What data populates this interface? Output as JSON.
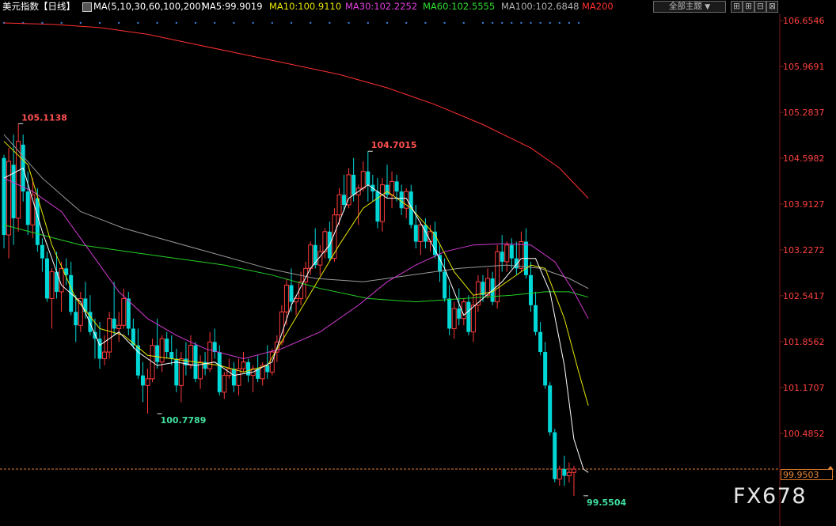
{
  "header": {
    "instrument": "美元指数",
    "period": "【日线】",
    "ma_set": "MA(5,10,30,60,100,200)",
    "ma5": "MA5:99.9019",
    "ma10": "MA10:100.9110",
    "ma30": "MA30:102.2252",
    "ma60": "MA60:102.5555",
    "ma100": "MA100:102.6848",
    "ma200": "MA200",
    "theme_select": "全部主题",
    "theme_arrow": "▼",
    "buttons": [
      "⊞",
      "⊞",
      "⊟",
      "⊠"
    ]
  },
  "watermark": "FX678",
  "current_price": "99.9503",
  "colors": {
    "up": "#ff3b3b",
    "down": "#00d8d8",
    "ma5": "#ffffff",
    "ma10": "#e6e600",
    "ma30": "#d23ad2",
    "ma60": "#26d026",
    "ma100": "#9a9a9a",
    "ma200": "#ff3030",
    "axis_text": "#ff4040",
    "current_line": "#e07a30"
  },
  "chart_data": {
    "type": "candlestick",
    "ylim": [
      99.3,
      106.75
    ],
    "y_ticks": [
      "106.6546",
      "105.9691",
      "105.2837",
      "104.5982",
      "103.9127",
      "103.2272",
      "102.5417",
      "101.8562",
      "101.1707",
      "100.4852",
      "99.9503"
    ],
    "annotations": [
      {
        "text": "105.1138",
        "value": 105.1138,
        "index": 3
      },
      {
        "text": "104.7015",
        "value": 104.7015,
        "index": 76
      },
      {
        "text": "100.7789",
        "value": 100.7789,
        "index": 32
      },
      {
        "text": "99.5504",
        "value": 99.5504,
        "index": 121
      }
    ],
    "ohlc": [
      [
        104.6,
        104.65,
        103.25,
        103.45
      ],
      [
        103.45,
        104.75,
        103.1,
        104.55
      ],
      [
        104.5,
        104.95,
        103.3,
        103.7
      ],
      [
        103.7,
        105.11,
        103.5,
        104.85
      ],
      [
        104.8,
        104.95,
        103.95,
        104.1
      ],
      [
        104.1,
        104.4,
        103.45,
        103.6
      ],
      [
        103.6,
        104.3,
        103.4,
        104.05
      ],
      [
        104.0,
        104.15,
        103.2,
        103.3
      ],
      [
        103.3,
        103.4,
        102.9,
        103.1
      ],
      [
        103.1,
        103.2,
        102.45,
        102.5
      ],
      [
        102.5,
        102.95,
        102.05,
        102.9
      ],
      [
        102.9,
        103.2,
        102.5,
        102.6
      ],
      [
        102.6,
        103.05,
        102.3,
        102.95
      ],
      [
        102.95,
        103.1,
        102.7,
        102.85
      ],
      [
        102.85,
        103.05,
        102.25,
        102.3
      ],
      [
        102.3,
        102.55,
        101.85,
        102.1
      ],
      [
        102.1,
        102.6,
        102.0,
        102.5
      ],
      [
        102.5,
        102.75,
        102.2,
        102.3
      ],
      [
        102.3,
        102.55,
        101.95,
        102.0
      ],
      [
        102.0,
        102.2,
        101.6,
        101.9
      ],
      [
        101.9,
        102.15,
        101.45,
        101.6
      ],
      [
        101.6,
        101.95,
        101.5,
        101.7
      ],
      [
        101.7,
        102.3,
        101.6,
        102.2
      ],
      [
        102.2,
        102.75,
        101.95,
        102.05
      ],
      [
        102.05,
        102.3,
        101.85,
        102.1
      ],
      [
        102.1,
        102.65,
        102.05,
        102.5
      ],
      [
        102.5,
        102.6,
        101.95,
        102.05
      ],
      [
        102.05,
        102.2,
        101.75,
        101.8
      ],
      [
        101.8,
        102.05,
        101.3,
        101.35
      ],
      [
        101.35,
        101.55,
        100.95,
        101.2
      ],
      [
        101.2,
        101.45,
        100.78,
        101.3
      ],
      [
        101.3,
        101.9,
        101.25,
        101.8
      ],
      [
        101.8,
        102.2,
        101.45,
        101.55
      ],
      [
        101.55,
        101.95,
        101.4,
        101.9
      ],
      [
        101.9,
        102.0,
        101.6,
        101.7
      ],
      [
        101.7,
        101.95,
        101.5,
        101.6
      ],
      [
        101.6,
        101.75,
        101.1,
        101.2
      ],
      [
        101.2,
        101.7,
        100.95,
        101.6
      ],
      [
        101.6,
        101.85,
        101.35,
        101.5
      ],
      [
        101.5,
        101.95,
        101.45,
        101.8
      ],
      [
        101.8,
        101.85,
        101.25,
        101.3
      ],
      [
        101.3,
        101.65,
        101.15,
        101.55
      ],
      [
        101.55,
        101.7,
        101.35,
        101.45
      ],
      [
        101.45,
        102.0,
        101.4,
        101.85
      ],
      [
        101.85,
        102.05,
        101.6,
        101.7
      ],
      [
        101.7,
        101.8,
        101.05,
        101.1
      ],
      [
        101.1,
        101.4,
        101.0,
        101.35
      ],
      [
        101.35,
        101.6,
        101.3,
        101.45
      ],
      [
        101.45,
        101.55,
        101.1,
        101.2
      ],
      [
        101.2,
        101.6,
        101.05,
        101.45
      ],
      [
        101.45,
        101.7,
        101.4,
        101.55
      ],
      [
        101.55,
        101.6,
        101.25,
        101.35
      ],
      [
        101.35,
        101.5,
        101.1,
        101.45
      ],
      [
        101.45,
        101.65,
        101.25,
        101.3
      ],
      [
        101.3,
        101.55,
        101.2,
        101.5
      ],
      [
        101.5,
        101.8,
        101.3,
        101.4
      ],
      [
        101.4,
        101.75,
        101.35,
        101.7
      ],
      [
        101.7,
        101.95,
        101.55,
        101.85
      ],
      [
        101.85,
        102.4,
        101.8,
        102.3
      ],
      [
        102.3,
        102.8,
        102.1,
        102.7
      ],
      [
        102.7,
        102.95,
        102.3,
        102.45
      ],
      [
        102.45,
        102.55,
        102.25,
        102.5
      ],
      [
        102.5,
        102.9,
        102.4,
        102.75
      ],
      [
        102.75,
        103.05,
        102.5,
        102.95
      ],
      [
        102.95,
        103.35,
        102.85,
        103.3
      ],
      [
        103.3,
        103.55,
        102.95,
        103.0
      ],
      [
        103.0,
        103.3,
        102.85,
        103.2
      ],
      [
        103.2,
        103.55,
        103.1,
        103.5
      ],
      [
        103.5,
        103.65,
        103.05,
        103.1
      ],
      [
        103.1,
        103.85,
        103.05,
        103.75
      ],
      [
        103.75,
        104.15,
        103.6,
        104.05
      ],
      [
        104.05,
        104.35,
        103.8,
        103.9
      ],
      [
        103.9,
        104.45,
        103.85,
        104.35
      ],
      [
        104.35,
        104.6,
        103.95,
        104.05
      ],
      [
        104.05,
        104.2,
        103.6,
        104.15
      ],
      [
        104.15,
        104.55,
        104.1,
        104.4
      ],
      [
        104.4,
        104.7,
        103.95,
        104.2
      ],
      [
        104.2,
        104.35,
        103.95,
        104.1
      ],
      [
        104.1,
        104.3,
        103.55,
        103.65
      ],
      [
        103.65,
        104.3,
        103.5,
        104.2
      ],
      [
        104.2,
        104.5,
        104.0,
        104.05
      ],
      [
        104.05,
        104.4,
        103.85,
        104.25
      ],
      [
        104.25,
        104.35,
        103.95,
        104.1
      ],
      [
        104.1,
        104.2,
        103.75,
        103.85
      ],
      [
        103.85,
        104.15,
        103.7,
        104.1
      ],
      [
        104.1,
        104.2,
        103.55,
        103.6
      ],
      [
        103.6,
        103.9,
        103.25,
        103.35
      ],
      [
        103.35,
        103.65,
        103.15,
        103.6
      ],
      [
        103.6,
        103.7,
        103.25,
        103.35
      ],
      [
        103.35,
        103.6,
        103.2,
        103.5
      ],
      [
        103.5,
        103.65,
        103.1,
        103.15
      ],
      [
        103.15,
        103.3,
        102.75,
        102.9
      ],
      [
        102.9,
        103.1,
        102.45,
        102.5
      ],
      [
        102.5,
        102.7,
        101.95,
        102.05
      ],
      [
        102.05,
        102.45,
        101.9,
        102.35
      ],
      [
        102.35,
        102.65,
        102.1,
        102.2
      ],
      [
        102.2,
        102.5,
        102.1,
        102.45
      ],
      [
        102.45,
        102.55,
        101.95,
        102.0
      ],
      [
        102.0,
        102.55,
        101.85,
        102.4
      ],
      [
        102.4,
        102.85,
        102.3,
        102.75
      ],
      [
        102.75,
        102.85,
        102.45,
        102.55
      ],
      [
        102.55,
        102.95,
        102.5,
        102.8
      ],
      [
        102.8,
        102.9,
        102.4,
        102.45
      ],
      [
        102.45,
        103.3,
        102.35,
        103.2
      ],
      [
        103.2,
        103.45,
        102.9,
        103.05
      ],
      [
        103.05,
        103.35,
        102.9,
        103.3
      ],
      [
        103.3,
        103.4,
        102.95,
        103.1
      ],
      [
        103.1,
        103.35,
        102.85,
        102.95
      ],
      [
        102.95,
        103.5,
        102.9,
        103.35
      ],
      [
        103.35,
        103.55,
        102.8,
        102.85
      ],
      [
        102.85,
        103.05,
        102.3,
        102.4
      ],
      [
        102.4,
        102.6,
        101.95,
        102.0
      ],
      [
        102.0,
        102.15,
        101.65,
        101.7
      ],
      [
        101.7,
        101.85,
        101.15,
        101.2
      ],
      [
        101.2,
        101.25,
        100.45,
        100.5
      ],
      [
        100.5,
        100.55,
        99.75,
        99.8
      ],
      [
        99.8,
        100.0,
        99.7,
        99.95
      ],
      [
        99.95,
        100.15,
        99.7,
        99.85
      ],
      [
        99.85,
        100.05,
        99.75,
        99.9
      ],
      [
        99.9,
        100.0,
        99.55,
        99.95
      ]
    ],
    "ma_names": [
      "MA5",
      "MA10",
      "MA30",
      "MA60",
      "MA100",
      "MA200"
    ],
    "ma200": [
      [
        0,
        106.62
      ],
      [
        10,
        106.6
      ],
      [
        20,
        106.55
      ],
      [
        30,
        106.45
      ],
      [
        40,
        106.3
      ],
      [
        50,
        106.15
      ],
      [
        60,
        106.0
      ],
      [
        70,
        105.85
      ],
      [
        80,
        105.65
      ],
      [
        90,
        105.4
      ],
      [
        100,
        105.1
      ],
      [
        110,
        104.75
      ],
      [
        116,
        104.45
      ],
      [
        122,
        104.0
      ]
    ],
    "ma100": [
      [
        0,
        104.95
      ],
      [
        8,
        104.3
      ],
      [
        16,
        103.8
      ],
      [
        25,
        103.55
      ],
      [
        35,
        103.35
      ],
      [
        45,
        103.15
      ],
      [
        55,
        102.95
      ],
      [
        65,
        102.8
      ],
      [
        75,
        102.75
      ],
      [
        85,
        102.85
      ],
      [
        95,
        102.95
      ],
      [
        105,
        103.0
      ],
      [
        112,
        102.95
      ],
      [
        118,
        102.8
      ],
      [
        122,
        102.65
      ]
    ],
    "ma60": [
      [
        0,
        103.6
      ],
      [
        8,
        103.45
      ],
      [
        16,
        103.3
      ],
      [
        26,
        103.2
      ],
      [
        36,
        103.1
      ],
      [
        46,
        103.0
      ],
      [
        56,
        102.85
      ],
      [
        66,
        102.65
      ],
      [
        76,
        102.5
      ],
      [
        86,
        102.45
      ],
      [
        96,
        102.5
      ],
      [
        106,
        102.55
      ],
      [
        113,
        102.6
      ],
      [
        118,
        102.6
      ],
      [
        122,
        102.52
      ]
    ],
    "ma30": [
      [
        0,
        104.3
      ],
      [
        6,
        104.1
      ],
      [
        12,
        103.8
      ],
      [
        18,
        103.2
      ],
      [
        24,
        102.6
      ],
      [
        30,
        102.2
      ],
      [
        36,
        101.95
      ],
      [
        42,
        101.75
      ],
      [
        50,
        101.6
      ],
      [
        58,
        101.75
      ],
      [
        66,
        102.0
      ],
      [
        74,
        102.4
      ],
      [
        80,
        102.75
      ],
      [
        86,
        103.0
      ],
      [
        92,
        103.2
      ],
      [
        98,
        103.3
      ],
      [
        104,
        103.32
      ],
      [
        110,
        103.3
      ],
      [
        115,
        103.05
      ],
      [
        119,
        102.6
      ],
      [
        122,
        102.2
      ]
    ],
    "ma10": [
      [
        0,
        104.85
      ],
      [
        5,
        104.5
      ],
      [
        10,
        103.3
      ],
      [
        15,
        102.5
      ],
      [
        20,
        102.05
      ],
      [
        25,
        101.95
      ],
      [
        30,
        101.65
      ],
      [
        35,
        101.6
      ],
      [
        40,
        101.55
      ],
      [
        45,
        101.5
      ],
      [
        50,
        101.4
      ],
      [
        55,
        101.5
      ],
      [
        60,
        102.1
      ],
      [
        65,
        102.7
      ],
      [
        70,
        103.3
      ],
      [
        75,
        103.85
      ],
      [
        80,
        104.1
      ],
      [
        85,
        103.85
      ],
      [
        90,
        103.45
      ],
      [
        94,
        102.9
      ],
      [
        98,
        102.55
      ],
      [
        102,
        102.6
      ],
      [
        106,
        102.8
      ],
      [
        110,
        103.0
      ],
      [
        113,
        102.95
      ],
      [
        117,
        102.2
      ],
      [
        120,
        101.4
      ],
      [
        122,
        100.9
      ]
    ],
    "ma5": [
      [
        0,
        104.3
      ],
      [
        4,
        104.45
      ],
      [
        8,
        103.5
      ],
      [
        12,
        102.7
      ],
      [
        16,
        102.45
      ],
      [
        20,
        101.8
      ],
      [
        24,
        102.0
      ],
      [
        28,
        101.7
      ],
      [
        32,
        101.5
      ],
      [
        36,
        101.55
      ],
      [
        40,
        101.5
      ],
      [
        44,
        101.55
      ],
      [
        48,
        101.35
      ],
      [
        52,
        101.4
      ],
      [
        56,
        101.55
      ],
      [
        60,
        102.4
      ],
      [
        64,
        102.95
      ],
      [
        68,
        103.3
      ],
      [
        72,
        104.0
      ],
      [
        76,
        104.2
      ],
      [
        80,
        104.0
      ],
      [
        84,
        104.0
      ],
      [
        88,
        103.5
      ],
      [
        92,
        102.95
      ],
      [
        96,
        102.25
      ],
      [
        100,
        102.5
      ],
      [
        104,
        102.75
      ],
      [
        108,
        103.1
      ],
      [
        111,
        103.1
      ],
      [
        114,
        102.6
      ],
      [
        117,
        101.5
      ],
      [
        119,
        100.4
      ],
      [
        121,
        99.95
      ],
      [
        122,
        99.9
      ]
    ]
  }
}
